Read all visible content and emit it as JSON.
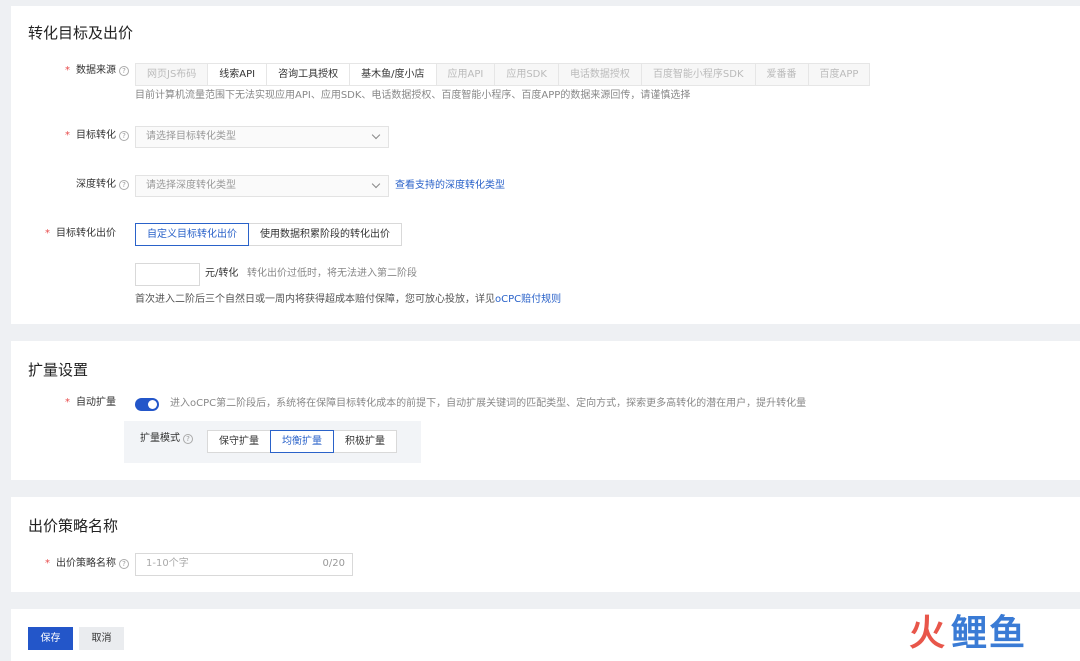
{
  "conversion": {
    "title": "转化目标及出价",
    "data_source": {
      "label": "数据来源",
      "tabs": [
        {
          "label": "网页JS布码",
          "enabled": false
        },
        {
          "label": "线索API",
          "enabled": true
        },
        {
          "label": "咨询工具授权",
          "enabled": true
        },
        {
          "label": "基木鱼/度小店",
          "enabled": true
        },
        {
          "label": "应用API",
          "enabled": false
        },
        {
          "label": "应用SDK",
          "enabled": false
        },
        {
          "label": "电话数据授权",
          "enabled": false
        },
        {
          "label": "百度智能小程序SDK",
          "enabled": false
        },
        {
          "label": "爱番番",
          "enabled": false
        },
        {
          "label": "百度APP",
          "enabled": false
        }
      ],
      "hint": "目前计算机流量范围下无法实现应用API、应用SDK、电话数据授权、百度智能小程序、百度APP的数据来源回传，请谨慎选择"
    },
    "target": {
      "label": "目标转化",
      "placeholder": "请选择目标转化类型"
    },
    "depth": {
      "label": "深度转化",
      "placeholder": "请选择深度转化类型",
      "link": "查看支持的深度转化类型"
    },
    "bid": {
      "label": "目标转化出价",
      "options": [
        "自定义目标转化出价",
        "使用数据积累阶段的转化出价"
      ],
      "unit": "元/转化",
      "unit_hint": "转化出价过低时，将无法进入第二阶段",
      "note": "首次进入二阶后三个自然日或一周内将获得超成本赔付保障，您可放心投放，详见",
      "note_link": "oCPC赔付规则"
    }
  },
  "expand": {
    "title": "扩量设置",
    "auto": {
      "label": "自动扩量",
      "on": true,
      "desc": "进入oCPC第二阶段后，系统将在保障目标转化成本的前提下，自动扩展关键词的匹配类型、定向方式，探索更多高转化的潜在用户，提升转化量"
    },
    "mode": {
      "label": "扩量模式",
      "options": [
        "保守扩量",
        "均衡扩量",
        "积极扩量"
      ],
      "selected": "均衡扩量"
    }
  },
  "strategy": {
    "title": "出价策略名称",
    "label": "出价策略名称",
    "placeholder": "1-10个字",
    "counter": "0/20"
  },
  "footer": {
    "save": "保存",
    "cancel": "取消"
  },
  "colors": {
    "primary": "#2356c9",
    "required": "#e84a4a"
  }
}
